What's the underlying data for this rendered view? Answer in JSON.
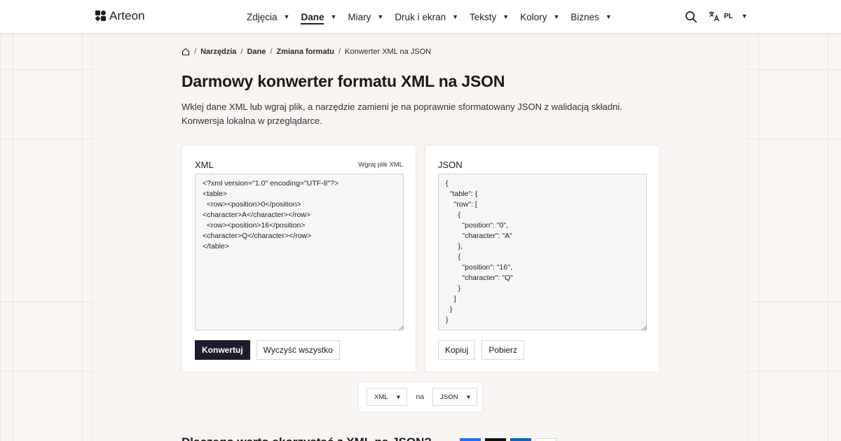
{
  "header": {
    "brand": "Arteon",
    "nav": [
      {
        "label": "Zdjęcia",
        "active": false
      },
      {
        "label": "Dane",
        "active": true
      },
      {
        "label": "Miary",
        "active": false
      },
      {
        "label": "Druk i ekran",
        "active": false
      },
      {
        "label": "Teksty",
        "active": false
      },
      {
        "label": "Kolory",
        "active": false
      },
      {
        "label": "Biznes",
        "active": false
      }
    ],
    "language": "PL",
    "icons": {
      "search": "search-icon",
      "language": "translate-icon",
      "home": "home-icon"
    }
  },
  "breadcrumb": {
    "items": [
      "Narzędzia",
      "Dane",
      "Zmiana formatu"
    ],
    "current": "Konwerter XML na JSON"
  },
  "page": {
    "title": "Darmowy konwerter formatu XML na JSON",
    "intro": "Wklej dane XML lub wgraj plik, a narzędzie zamieni je na poprawnie sformatowany JSON z walidacją składni. Konwersja lokalna w przeglądarce."
  },
  "input_panel": {
    "title": "XML",
    "upload_label": "Wgraj plik XML",
    "value": "<?xml version=\"1.0\" encoding=\"UTF-8\"?>\n<table>\n  <row><position>0</position>\n<character>A</character></row>\n  <row><position>16</position>\n<character>Q</character></row>\n</table>",
    "convert_label": "Konwertuj",
    "clear_label": "Wyczyść wszystko"
  },
  "output_panel": {
    "title": "JSON",
    "value": "{\n  \"table\": {\n    \"row\": [\n      {\n        \"position\": \"0\",\n        \"character\": \"A\"\n      },\n      {\n        \"position\": \"16\",\n        \"character\": \"Q\"\n      }\n    ]\n  }\n}",
    "copy_label": "Kopiuj",
    "download_label": "Pobierz"
  },
  "format_selector": {
    "from": "XML",
    "joiner": "na",
    "to": "JSON"
  },
  "section": {
    "heading": "Dlaczego warto skorzystać z XML na JSON?"
  },
  "colors": {
    "primary_button": "#1c1e2e",
    "background": "#f8f5f2",
    "panel": "#ffffff"
  }
}
